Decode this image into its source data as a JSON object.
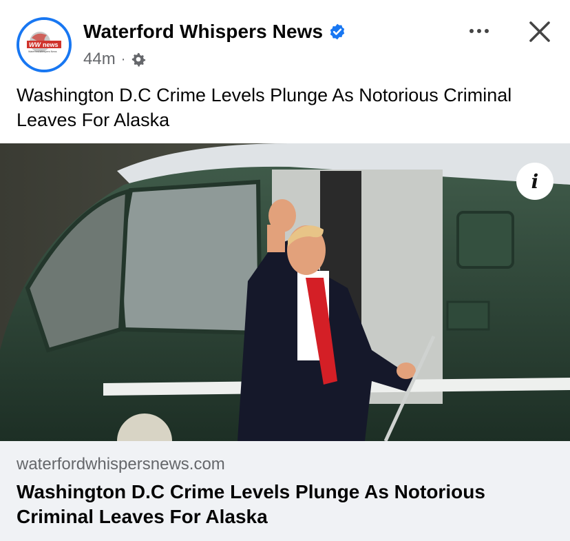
{
  "post": {
    "page_name": "Waterford Whispers News",
    "timestamp": "44m",
    "separator": "·",
    "caption": "Washington D.C Crime Levels Plunge As Notorious Criminal Leaves For Alaska",
    "verified_icon": "verified-badge-icon",
    "privacy_icon": "gear-icon",
    "brand_color": "#1877f2"
  },
  "avatar_logo": {
    "logo_text_top": "WW",
    "logo_text_badge": "news",
    "logo_text_small": "Waterford Whispers News"
  },
  "photo": {
    "info_label": "i"
  },
  "link_card": {
    "domain": "waterfordwhispersnews.com",
    "title": "Washington D.C Crime Levels Plunge As Notorious Criminal Leaves For Alaska"
  }
}
